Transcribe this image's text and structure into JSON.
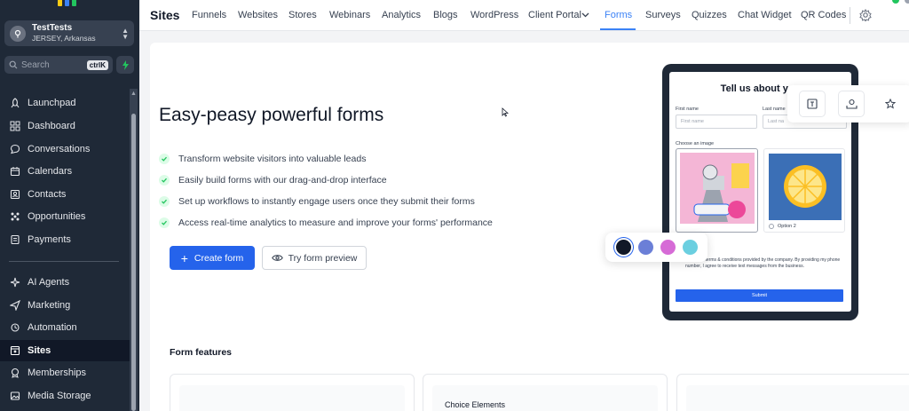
{
  "colors": {
    "accent": "#3b82f6",
    "primary_button": "#2563eb",
    "sidebar_bg": "#1f2937",
    "check_green": "#22c55e"
  },
  "sidebar": {
    "account": {
      "name": "TestTests",
      "location": "JERSEY, Arkansas"
    },
    "search": {
      "placeholder": "Search",
      "shortcut": "ctrlK"
    },
    "items": [
      {
        "label": "Launchpad",
        "icon": "rocket-icon"
      },
      {
        "label": "Dashboard",
        "icon": "dashboard-icon"
      },
      {
        "label": "Conversations",
        "icon": "chat-icon"
      },
      {
        "label": "Calendars",
        "icon": "calendar-icon"
      },
      {
        "label": "Contacts",
        "icon": "contacts-icon"
      },
      {
        "label": "Opportunities",
        "icon": "opportunities-icon"
      },
      {
        "label": "Payments",
        "icon": "payments-icon"
      },
      {
        "label": "AI Agents",
        "icon": "sparkle-icon"
      },
      {
        "label": "Marketing",
        "icon": "send-icon"
      },
      {
        "label": "Automation",
        "icon": "automation-icon"
      },
      {
        "label": "Sites",
        "icon": "sites-icon",
        "active": true
      },
      {
        "label": "Memberships",
        "icon": "memberships-icon"
      },
      {
        "label": "Media Storage",
        "icon": "image-icon"
      }
    ]
  },
  "topbar": {
    "title": "Sites",
    "tabs": [
      "Funnels",
      "Websites",
      "Stores",
      "Webinars",
      "Analytics",
      "Blogs",
      "WordPress",
      "Client Portal",
      "Forms",
      "Surveys",
      "Quizzes",
      "Chat Widget",
      "QR Codes"
    ],
    "active_tab": "Forms"
  },
  "hero": {
    "title": "Easy-peasy powerful forms",
    "features": [
      "Transform website visitors into valuable leads",
      "Easily build forms with our drag-and-drop interface",
      "Set up workflows to instantly engage users once they submit their forms",
      "Access real-time analytics to measure and improve your forms' performance"
    ],
    "primary_button": "Create form",
    "secondary_button": "Try form preview"
  },
  "preview": {
    "title": "Tell us about you",
    "first_name_label": "First name",
    "first_name_placeholder": "First name",
    "last_name_label": "Last name",
    "last_name_placeholder": "Last na",
    "choose_image_label": "Choose an image",
    "option_2": "Option 2",
    "terms_text": "I agree to terms & conditions provided by the company. By providing my phone number, I agree to receive text messages from the business.",
    "submit": "Submit",
    "swatches": [
      "#111827",
      "#6b7fd7",
      "#d66bd6",
      "#6bcfe0"
    ]
  },
  "form_features": {
    "title": "Form features",
    "cards": [
      "",
      "Choice Elements",
      ""
    ]
  }
}
